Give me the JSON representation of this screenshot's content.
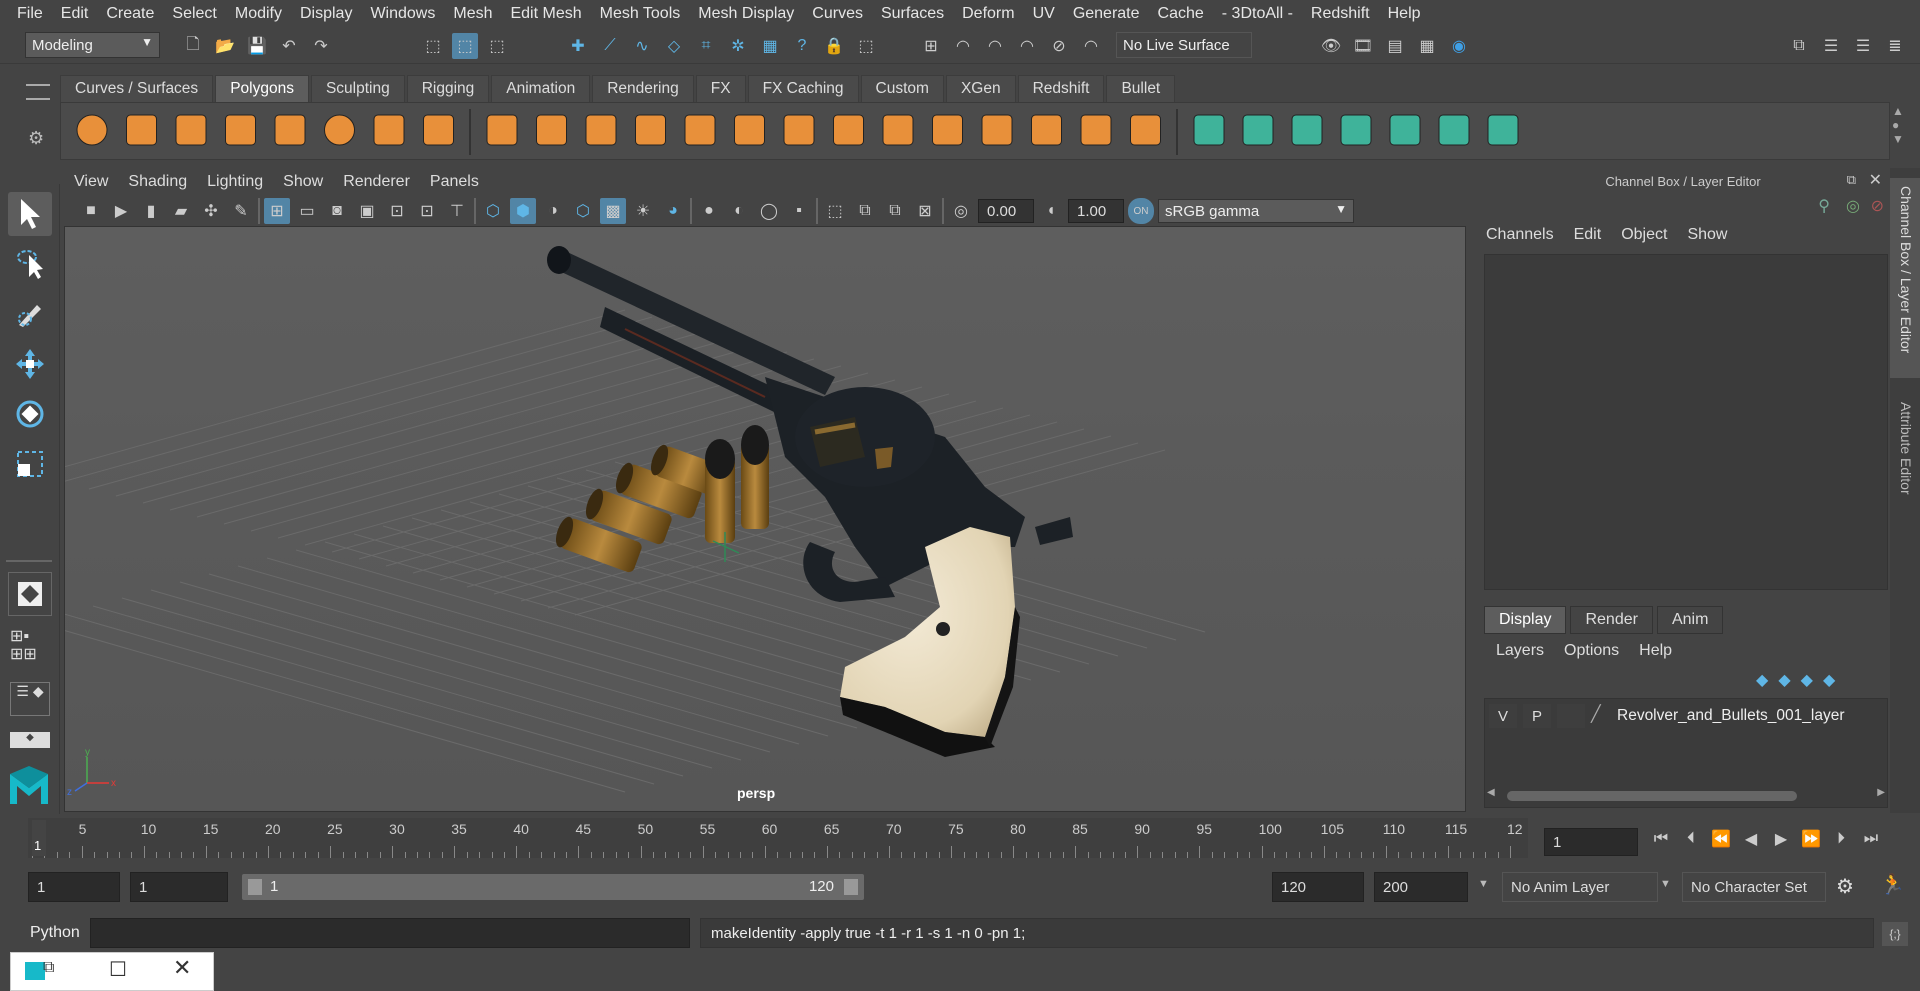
{
  "menubar": [
    "File",
    "Edit",
    "Create",
    "Select",
    "Modify",
    "Display",
    "Windows",
    "Mesh",
    "Edit Mesh",
    "Mesh Tools",
    "Mesh Display",
    "Curves",
    "Surfaces",
    "Deform",
    "UV",
    "Generate",
    "Cache",
    "- 3DtoAll -",
    "Redshift",
    "Help"
  ],
  "statusline": {
    "mode": "Modeling",
    "live_surface": "No Live Surface"
  },
  "shelf_tabs": [
    "Curves / Surfaces",
    "Polygons",
    "Sculpting",
    "Rigging",
    "Animation",
    "Rendering",
    "FX",
    "FX Caching",
    "Custom",
    "XGen",
    "Redshift",
    "Bullet"
  ],
  "shelf_active": "Polygons",
  "viewport_menu": [
    "View",
    "Shading",
    "Lighting",
    "Show",
    "Renderer",
    "Panels"
  ],
  "viewport_toolbar": {
    "exposure": "0.00",
    "gamma": "1.00",
    "colorspace": "sRGB gamma"
  },
  "viewport_label": "persp",
  "channel_box": {
    "title": "Channel Box / Layer Editor",
    "menu": [
      "Channels",
      "Edit",
      "Object",
      "Show"
    ],
    "layer_tabs": [
      "Display",
      "Render",
      "Anim"
    ],
    "layer_menu": [
      "Layers",
      "Options",
      "Help"
    ],
    "layer": {
      "v": "V",
      "p": "P",
      "name": "Revolver_and_Bullets_001_layer"
    }
  },
  "side_tabs": [
    "Channel Box / Layer Editor",
    "Attribute Editor"
  ],
  "timeline": {
    "ticks": [
      "5",
      "10",
      "15",
      "20",
      "25",
      "30",
      "35",
      "40",
      "45",
      "50",
      "55",
      "60",
      "65",
      "70",
      "75",
      "80",
      "85",
      "90",
      "95",
      "100",
      "105",
      "110",
      "115",
      "12"
    ],
    "current_frame_marker": "1",
    "current_frame": "1"
  },
  "range": {
    "start": "1",
    "playback_start": "1",
    "slider_start": "1",
    "slider_end": "120",
    "playback_end": "120",
    "end": "200",
    "anim_layer": "No Anim Layer",
    "char_set": "No Character Set"
  },
  "cmdline": {
    "lang": "Python",
    "result": "makeIdentity -apply true -t 1 -r 1 -s 1 -n 0 -pn 1;"
  },
  "colors": {
    "accent": "#5285a6",
    "shelf_orange": "#e8903a",
    "shelf_green": "#3fb39a",
    "grip": "#ece1c8"
  }
}
